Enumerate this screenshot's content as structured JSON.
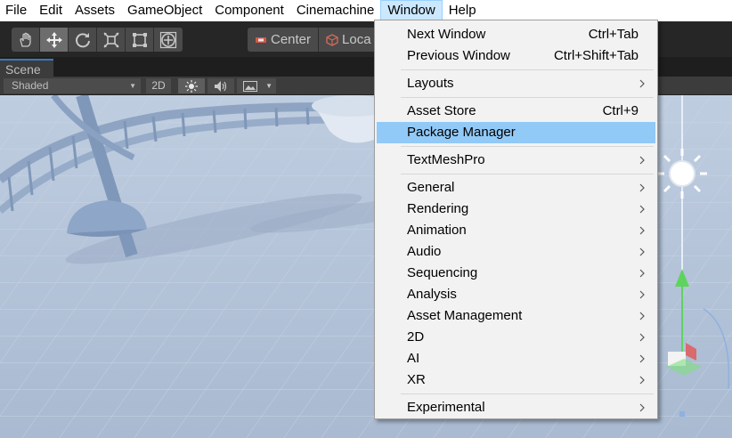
{
  "menubar": {
    "items": [
      {
        "label": "File"
      },
      {
        "label": "Edit"
      },
      {
        "label": "Assets"
      },
      {
        "label": "GameObject"
      },
      {
        "label": "Component"
      },
      {
        "label": "Cinemachine"
      },
      {
        "label": "Window"
      },
      {
        "label": "Help"
      }
    ],
    "active": "Window"
  },
  "toolbar": {
    "tools": [
      "hand-tool-icon",
      "move-tool-icon",
      "rotate-tool-icon",
      "scale-tool-icon",
      "rect-tool-icon",
      "transform-tool-icon"
    ],
    "active_tool": "move-tool-icon",
    "pivot_label": "Center",
    "space_label": "Loca"
  },
  "scene": {
    "tab_label": "Scene",
    "shading_mode": "Shaded",
    "mode_2d_label": "2D"
  },
  "window_menu": {
    "items": [
      {
        "label": "Next Window",
        "shortcut": "Ctrl+Tab"
      },
      {
        "label": "Previous Window",
        "shortcut": "Ctrl+Shift+Tab"
      },
      {
        "label": "Layouts",
        "submenu": true
      },
      {
        "label": "Asset Store",
        "shortcut": "Ctrl+9"
      },
      {
        "label": "Package Manager",
        "highlighted": true
      },
      {
        "label": "TextMeshPro",
        "submenu": true
      },
      {
        "label": "General",
        "submenu": true
      },
      {
        "label": "Rendering",
        "submenu": true
      },
      {
        "label": "Animation",
        "submenu": true
      },
      {
        "label": "Audio",
        "submenu": true
      },
      {
        "label": "Sequencing",
        "submenu": true
      },
      {
        "label": "Analysis",
        "submenu": true
      },
      {
        "label": "Asset Management",
        "submenu": true
      },
      {
        "label": "2D",
        "submenu": true
      },
      {
        "label": "AI",
        "submenu": true
      },
      {
        "label": "XR",
        "submenu": true
      },
      {
        "label": "Experimental",
        "submenu": true
      }
    ]
  },
  "colors": {
    "menu_highlight": "#91c9f7",
    "menubar_active": "#cce8ff",
    "toolbar_bg": "#262626",
    "scene_sky": "#bccadb",
    "gizmo_green": "#5fd35f",
    "gizmo_red": "#e05a5a"
  }
}
